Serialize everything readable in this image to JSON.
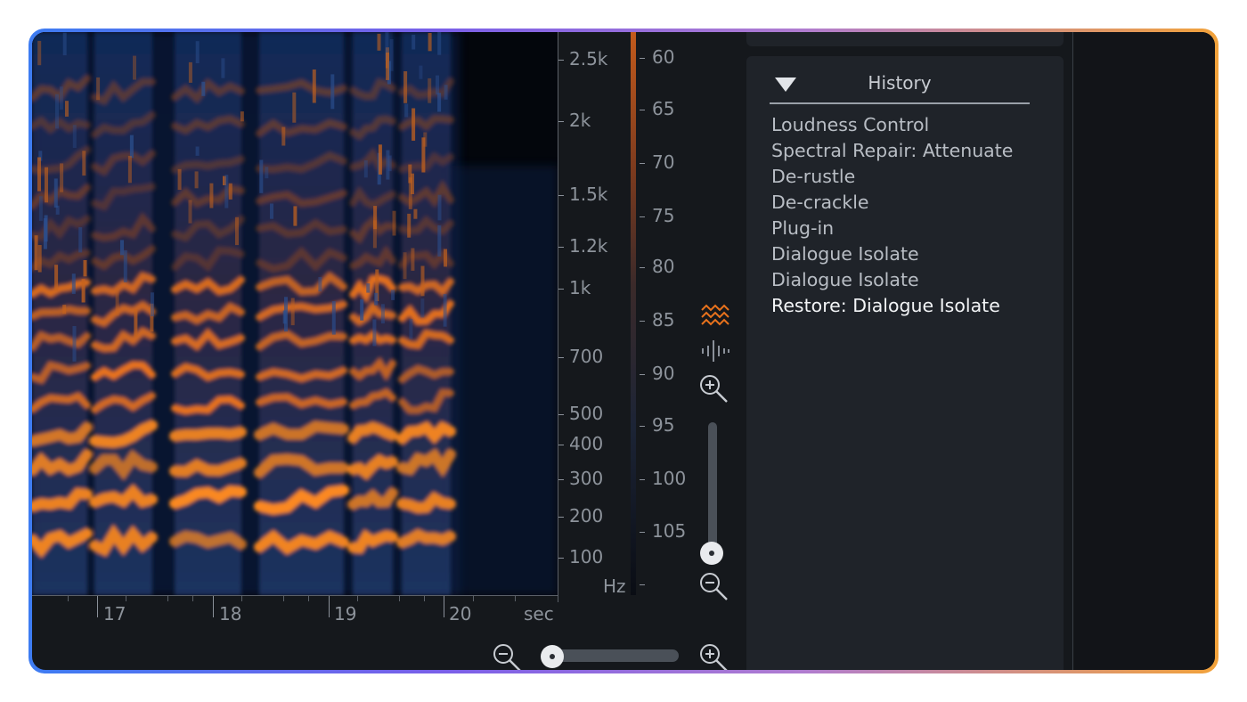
{
  "time_axis": {
    "labels": [
      "17",
      "18",
      "19",
      "20"
    ],
    "unit": "sec"
  },
  "frequency_axis": {
    "labels": [
      "2.5k",
      "2k",
      "1.5k",
      "1.2k",
      "1k",
      "700",
      "500",
      "400",
      "300",
      "200",
      "100"
    ],
    "unit": "Hz"
  },
  "db_scale": {
    "labels": [
      "60",
      "65",
      "70",
      "75",
      "80",
      "85",
      "90",
      "95",
      "100",
      "105"
    ]
  },
  "tools": {
    "spectrogram_icon": "spectrogram-mode-icon",
    "waveform_icon": "waveform-mode-icon",
    "zoom_in_icon": "zoom-in-icon",
    "zoom_out_icon": "zoom-out-icon",
    "vertical_zoom_level": 0.1,
    "horizontal_zoom_level": 0.08
  },
  "history": {
    "title": "History",
    "items": [
      "Loudness Control",
      "Spectral Repair: Attenuate",
      "De-rustle",
      "De-crackle",
      "Plug-in",
      "Dialogue Isolate",
      "Dialogue Isolate",
      "Restore: Dialogue Isolate"
    ],
    "active_index": 7
  },
  "colors": {
    "accent_orange": "#e8721c",
    "spectrogram_low": "#0d2a5a",
    "background": "#15181c"
  }
}
